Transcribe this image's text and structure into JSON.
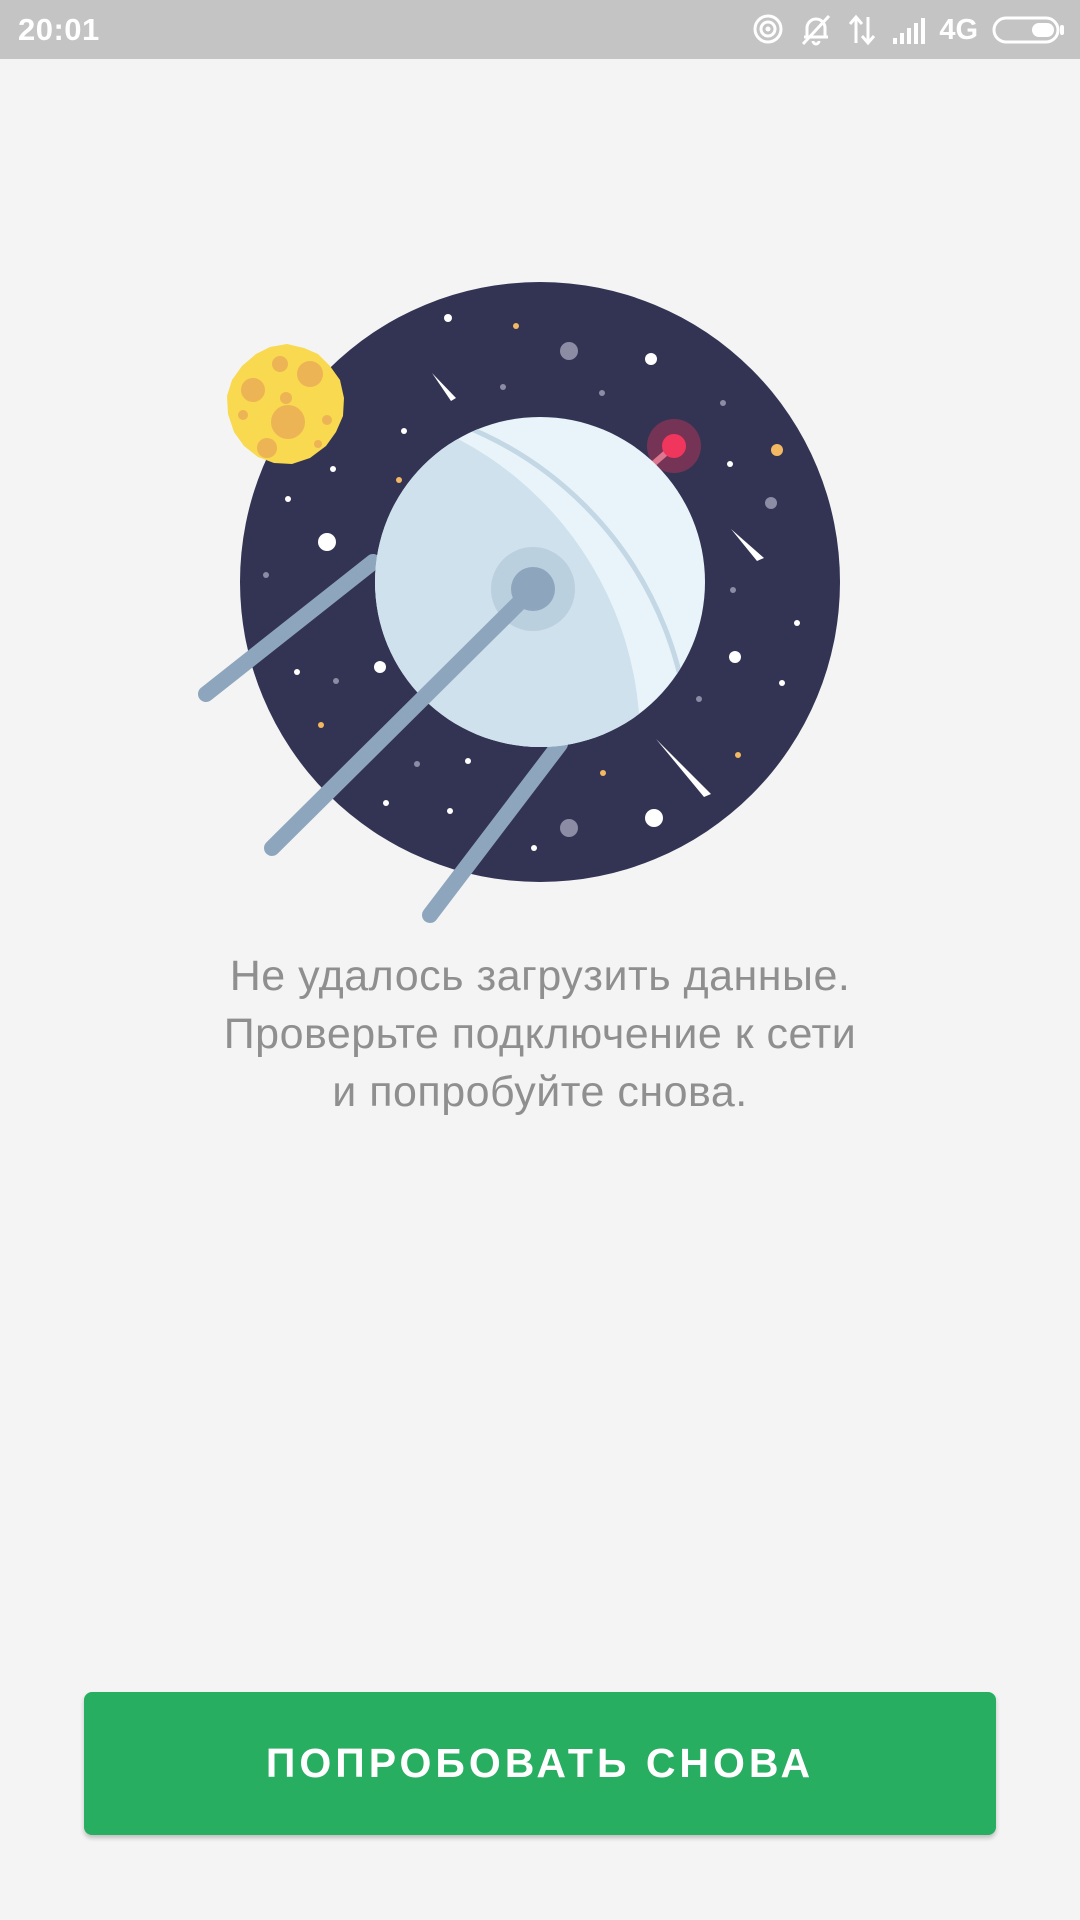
{
  "status_bar": {
    "time": "20:01",
    "network": "4G",
    "icons": [
      "hotspot-icon",
      "bell-off-icon",
      "data-arrows-icon",
      "signal-icon",
      "battery-icon"
    ]
  },
  "illustration": {
    "icons": [
      "sputnik-icon",
      "moon-icon"
    ],
    "colors": {
      "space": "#333354",
      "moon": "#f9d94f",
      "satellite": "#e8f4fa",
      "antenna": "#8ea6bd",
      "beacon": "#f0365c"
    }
  },
  "message": {
    "lines": [
      "Не удалось загрузить данные.",
      "Проверьте подключение к сети",
      "и попробуйте снова."
    ]
  },
  "retry_button": {
    "label": "ПОПРОБОВАТЬ СНОВА",
    "color": "#27ae60"
  }
}
